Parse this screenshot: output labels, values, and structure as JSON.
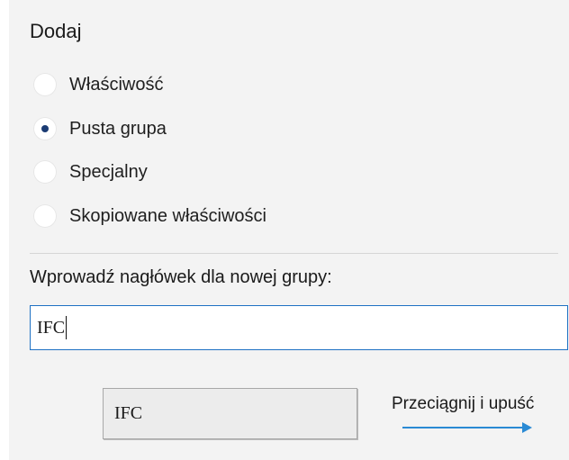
{
  "add_section": {
    "title": "Dodaj",
    "options": [
      {
        "label": "Właściwość",
        "selected": false
      },
      {
        "label": "Pusta grupa",
        "selected": true
      },
      {
        "label": "Specjalny",
        "selected": false
      },
      {
        "label": "Skopiowane właściwości",
        "selected": false
      }
    ]
  },
  "group_header": {
    "prompt": "Wprowadź nagłówek dla nowej grupy:",
    "value": "IFC"
  },
  "preview": {
    "item_label": "IFC",
    "drag_hint": "Przeciągnij i upuść"
  },
  "colors": {
    "accent": "#1e71c3",
    "radio_dot": "#1a3b73",
    "arrow": "#2a8ad4",
    "panel_bg": "#f3f3f3"
  },
  "icons": {
    "drag_arrow": "arrow-right-icon"
  }
}
